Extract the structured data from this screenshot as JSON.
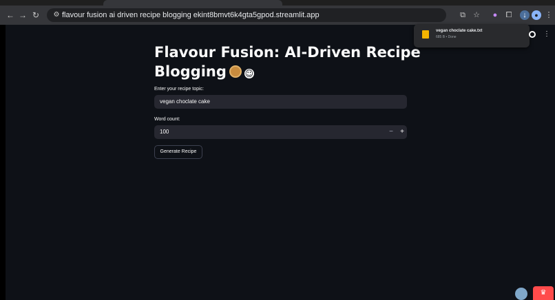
{
  "browser": {
    "url": "flavour fusion ai driven recipe blogging ekint8bmvt6k4gta5gpod.streamlit.app"
  },
  "main": {
    "title": "Flavour Fusion: AI-Driven Recipe Blogging",
    "topic_label": "Enter your recipe topic:",
    "topic_value": "vegan choclate cake",
    "word_count_label": "Word count:",
    "word_count_value": "100",
    "generate_label": "Generate Recipe"
  },
  "download": {
    "file_name": "vegan choclate cake.txt",
    "status": "685 B • Done"
  },
  "icons": {
    "stepper_minus": "−",
    "stepper_plus": "+"
  }
}
